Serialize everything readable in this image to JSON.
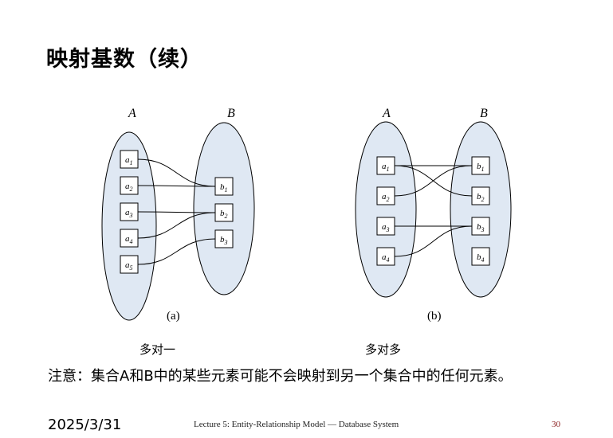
{
  "slide": {
    "title": "映射基数（续）",
    "note": "注意：集合A和B中的某些元素可能不会映射到另一个集合中的任何元素。",
    "date": "2025/3/31",
    "footer": "Lecture 5: Entity-Relationship Model — Database System",
    "page_number": "30"
  },
  "diagram_a": {
    "set_a_label": "A",
    "set_b_label": "B",
    "left_items": [
      {
        "base": "a",
        "sub": "1"
      },
      {
        "base": "a",
        "sub": "2"
      },
      {
        "base": "a",
        "sub": "3"
      },
      {
        "base": "a",
        "sub": "4"
      },
      {
        "base": "a",
        "sub": "5"
      }
    ],
    "right_items": [
      {
        "base": "b",
        "sub": "1"
      },
      {
        "base": "b",
        "sub": "2"
      },
      {
        "base": "b",
        "sub": "3"
      }
    ],
    "mappings": [
      [
        "a1",
        "b1"
      ],
      [
        "a2",
        "b1"
      ],
      [
        "a3",
        "b2"
      ],
      [
        "a4",
        "b2"
      ],
      [
        "a5",
        "b3"
      ]
    ],
    "panel_label": "(a)",
    "caption": "多对一"
  },
  "diagram_b": {
    "set_a_label": "A",
    "set_b_label": "B",
    "left_items": [
      {
        "base": "a",
        "sub": "1"
      },
      {
        "base": "a",
        "sub": "2"
      },
      {
        "base": "a",
        "sub": "3"
      },
      {
        "base": "a",
        "sub": "4"
      }
    ],
    "right_items": [
      {
        "base": "b",
        "sub": "1"
      },
      {
        "base": "b",
        "sub": "2"
      },
      {
        "base": "b",
        "sub": "3"
      },
      {
        "base": "b",
        "sub": "4"
      }
    ],
    "mappings": [
      [
        "a1",
        "b1"
      ],
      [
        "a1",
        "b2"
      ],
      [
        "a2",
        "b1"
      ],
      [
        "a3",
        "b3"
      ],
      [
        "a4",
        "b3"
      ]
    ],
    "panel_label": "(b)",
    "caption": "多对多"
  }
}
